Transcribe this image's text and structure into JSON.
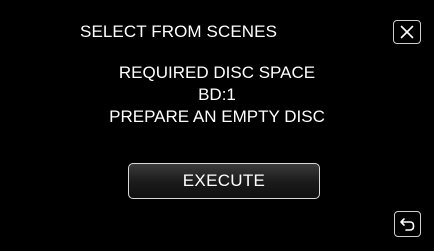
{
  "header": {
    "title": "SELECT FROM SCENES",
    "close_icon": "close-icon"
  },
  "message": {
    "line1": "REQUIRED DISC SPACE",
    "line2": "BD:1",
    "line3": "PREPARE AN EMPTY DISC"
  },
  "actions": {
    "execute_label": "EXECUTE",
    "back_icon": "return-arrow-icon"
  },
  "colors": {
    "background": "#000000",
    "text": "#ffffff",
    "button_border": "#d8d8d8"
  }
}
